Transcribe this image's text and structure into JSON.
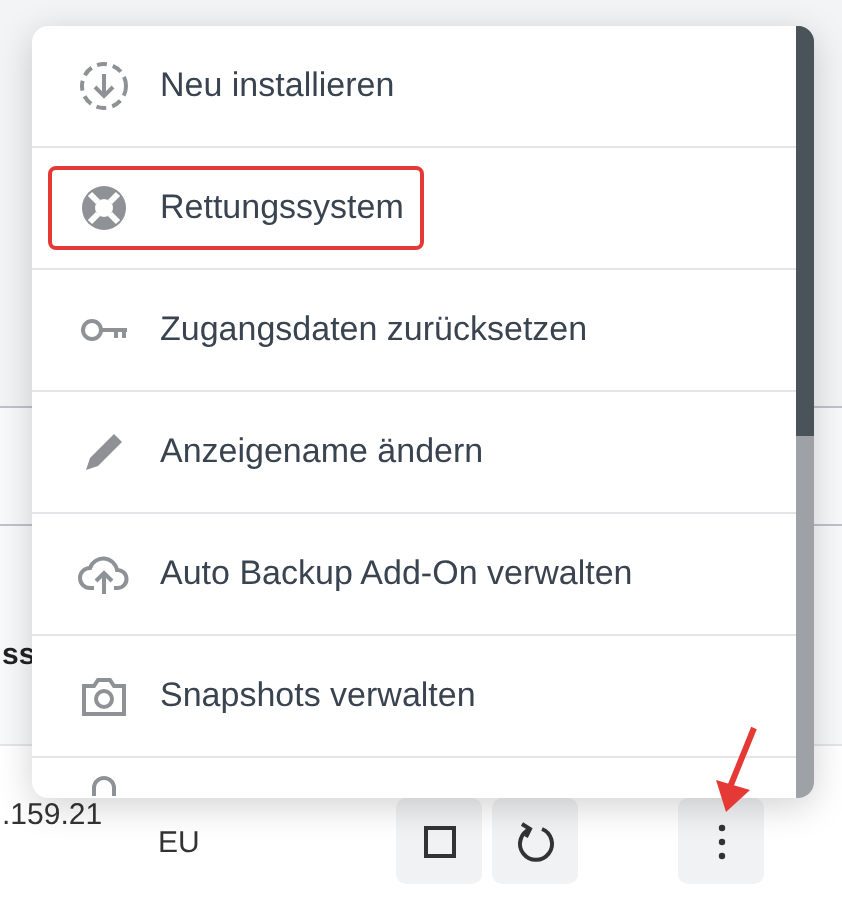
{
  "table": {
    "header": {
      "column_1": "ss"
    },
    "row": {
      "address": ".159.21",
      "region": "EU",
      "actions": [
        {
          "kind": "stop"
        },
        {
          "kind": "restart"
        },
        {
          "kind": "more"
        }
      ]
    }
  },
  "menu": {
    "items": [
      {
        "kind": "reinstall",
        "label": "Neu installieren",
        "highlighted": false
      },
      {
        "kind": "rescue",
        "label": "Rettungssystem",
        "highlighted": true
      },
      {
        "kind": "key",
        "label": "Zugangsdaten zurücksetzen",
        "highlighted": false
      },
      {
        "kind": "edit",
        "label": "Anzeigename ändern",
        "highlighted": false
      },
      {
        "kind": "backup",
        "label": "Auto Backup Add-On verwalten",
        "highlighted": false
      },
      {
        "kind": "snapshot",
        "label": "Snapshots verwalten",
        "highlighted": false
      }
    ]
  }
}
